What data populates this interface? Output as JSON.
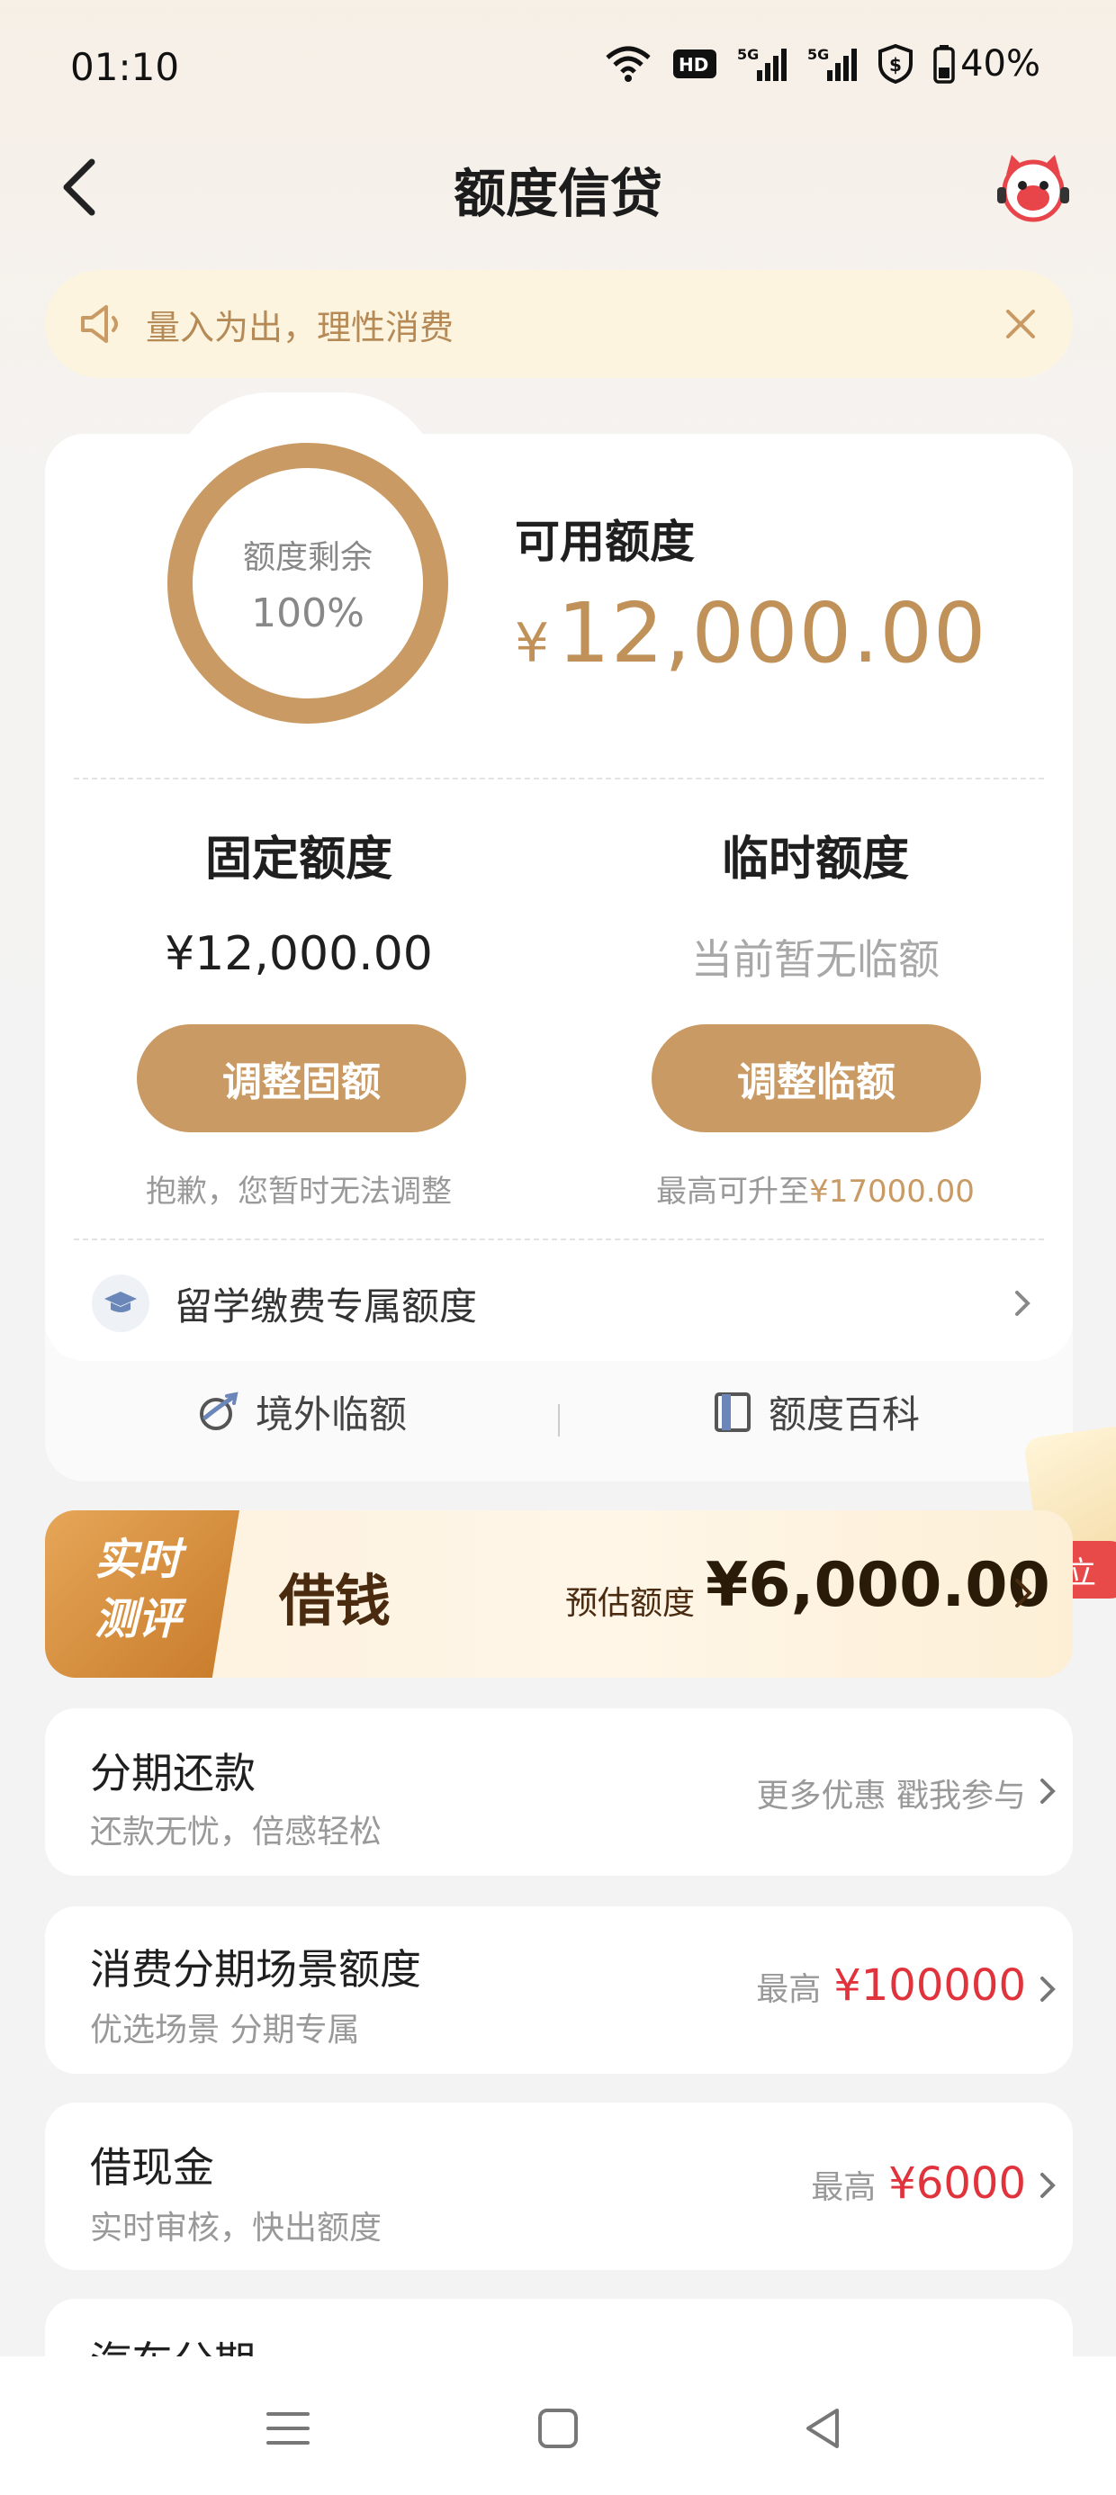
{
  "status": {
    "time": "01:10",
    "network1": "5G",
    "network2": "5G",
    "battery": "40%",
    "icons": [
      "wifi-icon",
      "hd-icon",
      "signal-5g-icon",
      "signal-5g-icon",
      "shield-dollar-icon",
      "battery-icon"
    ]
  },
  "nav": {
    "title": "额度信贷"
  },
  "notice": {
    "text": "量入为出，理性消费"
  },
  "quota": {
    "ring_label": "额度剩余",
    "ring_percent": "100%",
    "ring_fraction": 1.0,
    "available_label": "可用额度",
    "available_currency": "¥",
    "available_value": "12,000.00",
    "fixed": {
      "title": "固定额度",
      "value": "¥12,000.00",
      "button": "调整固额",
      "note": "抱歉，您暂时无法调整"
    },
    "temp": {
      "title": "临时额度",
      "value": "当前暂无临额",
      "button": "调整临额",
      "note_prefix": "最高可升至",
      "note_amount": "¥17000.00"
    },
    "study_abroad": "留学缴费专属额度",
    "quick_left": "境外临额",
    "quick_right": "额度百科"
  },
  "float_promo": {
    "button": "立"
  },
  "borrow_banner": {
    "badge_line1": "实时",
    "badge_line2": "测评",
    "title": "借钱",
    "estimate_label": "预估额度",
    "estimate_amount": "¥6,000.00"
  },
  "list": [
    {
      "title": "分期还款",
      "subtitle": "还款无忧，倍感轻松",
      "right_grey": "更多优惠 戳我参与",
      "right_red": ""
    },
    {
      "title": "消费分期场景额度",
      "subtitle": "优选场景 分期专属",
      "right_grey": "最高",
      "right_red": "¥100000"
    },
    {
      "title": "借现金",
      "subtitle": "实时审核，快出额度",
      "right_grey": "最高",
      "right_red": "¥6000"
    }
  ],
  "peek_item": {
    "title": "汽车分期"
  },
  "colors": {
    "gold": "#c99a63",
    "red": "#e0333c",
    "notice_bg": "#fcf4de"
  }
}
